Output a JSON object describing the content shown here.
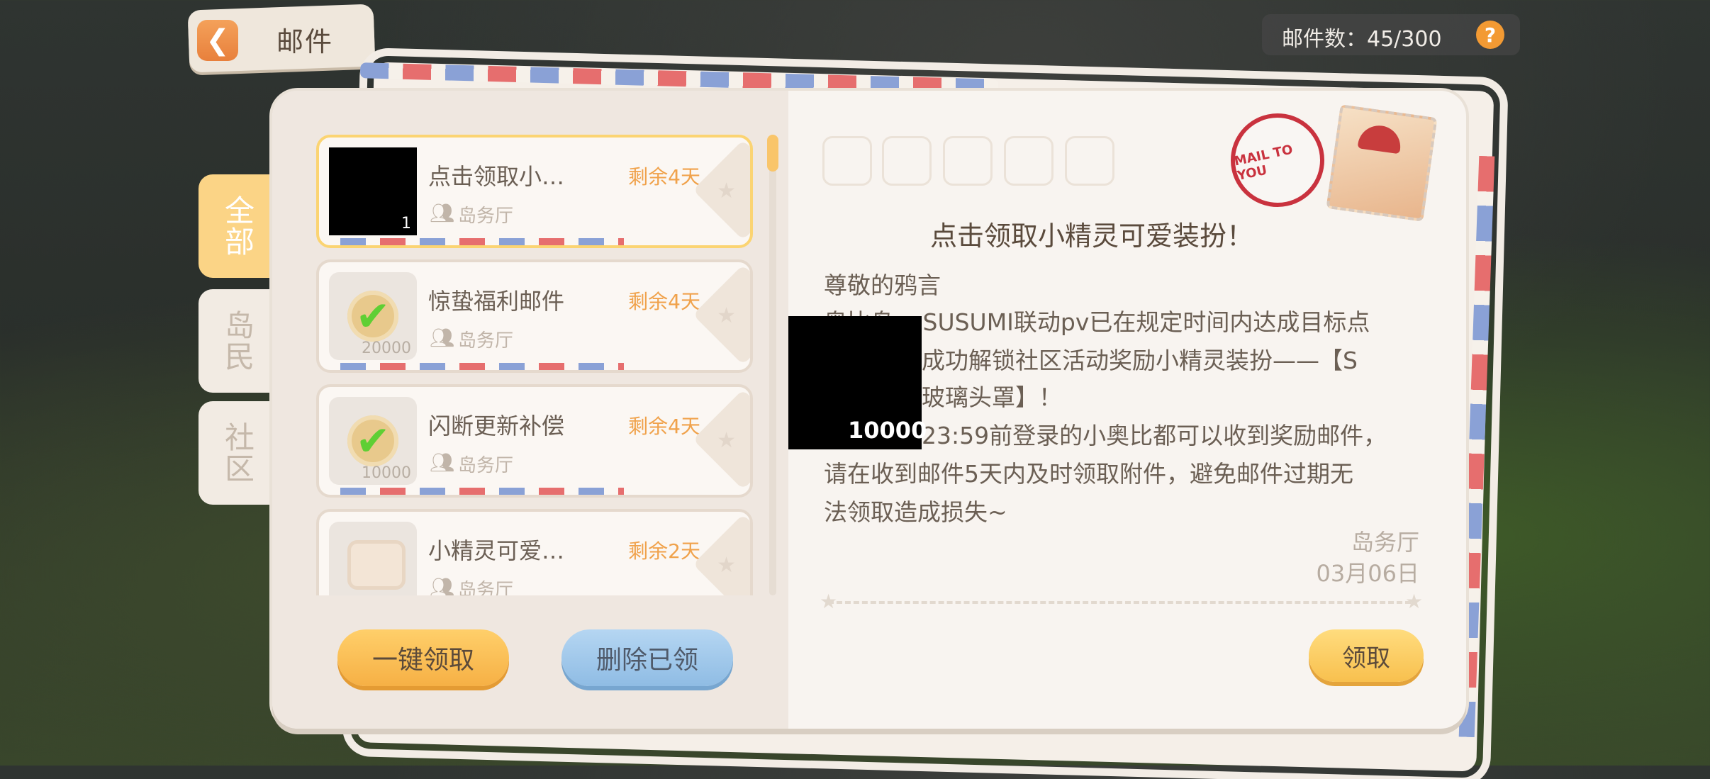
{
  "header": {
    "title": "邮件",
    "back_glyph": "❮",
    "mail_count_label": "邮件数：45/300",
    "help_glyph": "?"
  },
  "categories": [
    {
      "label": "全部",
      "active": true
    },
    {
      "label": "岛民",
      "active": false
    },
    {
      "label": "社区",
      "active": false
    }
  ],
  "mails": [
    {
      "title": "点击领取小…",
      "remain": "剩余4天",
      "sender": "岛务厅",
      "count": "1",
      "selected": true,
      "thumb": "redacted"
    },
    {
      "title": "惊蛰福利邮件",
      "remain": "剩余4天",
      "sender": "岛务厅",
      "count": "20000",
      "selected": false,
      "thumb": "check-icon"
    },
    {
      "title": "闪断更新补偿",
      "remain": "剩余4天",
      "sender": "岛务厅",
      "count": "10000",
      "selected": false,
      "thumb": "check-icon"
    },
    {
      "title": "小精灵可爱…",
      "remain": "剩余2天",
      "sender": "岛务厅",
      "count": "",
      "selected": false,
      "thumb": "box-icon"
    }
  ],
  "buttons": {
    "claim_all": "一键领取",
    "delete_claimed": "删除已领",
    "claim": "领取"
  },
  "detail": {
    "headline": "点击领取小精灵可爱装扮！",
    "greeting": "尊敬的鸦言",
    "lines": [
      "奥比岛 x SUSUMI联动pv已在规定时间内达成目标点",
      "成功解锁社区活动奖励小精灵装扮——【S",
      "玻璃头罩】！",
      "23:59前登录的小奥比都可以收到奖励邮件，",
      "请在收到邮件5天内及时领取附件，避免邮件过期无",
      "法领取造成损失~"
    ],
    "attachment_count": "10000",
    "signature": "岛务厅",
    "date": "03月06日",
    "stamp_text": "MAIL TO YOU"
  },
  "colors": {
    "accent_orange": "#f39a33",
    "remain_text": "#f0a24b",
    "selected_border": "#fbd472",
    "stamp_red": "#c9323e"
  }
}
